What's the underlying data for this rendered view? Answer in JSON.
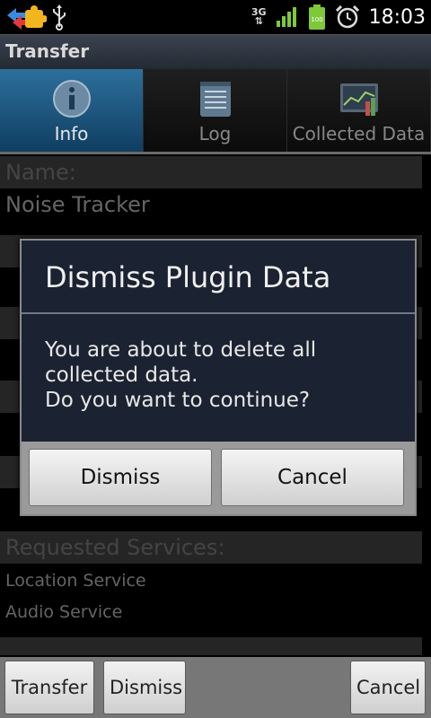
{
  "status": {
    "time": "18:03",
    "network": "3G",
    "battery": "100",
    "icons": [
      "puzzle-plugin-icon",
      "usb-icon",
      "signal-icon",
      "battery-icon",
      "alarm-icon"
    ]
  },
  "app": {
    "title": "Transfer"
  },
  "tabs": [
    {
      "label": "Info",
      "icon": "info-icon",
      "active": true
    },
    {
      "label": "Log",
      "icon": "notepad-icon",
      "active": false
    },
    {
      "label": "Collected Data",
      "icon": "chart-icon",
      "active": false
    }
  ],
  "content": {
    "name_header": "Name:",
    "name_value": "Noise Tracker",
    "services_header": "Requested Services:",
    "services": [
      "Location Service",
      "Audio Service"
    ]
  },
  "dialog": {
    "title": "Dismiss Plugin Data",
    "message": "You are about to delete all\ncollected data.\nDo you want to continue?",
    "dismiss_label": "Dismiss",
    "cancel_label": "Cancel"
  },
  "bottom": {
    "transfer_label": "Transfer",
    "dismiss_label": "Dismiss",
    "cancel_label": "Cancel"
  },
  "colors": {
    "tab_active": "#1f5a86",
    "dialog_bg": "#1b2231",
    "section_header": "#444444"
  }
}
